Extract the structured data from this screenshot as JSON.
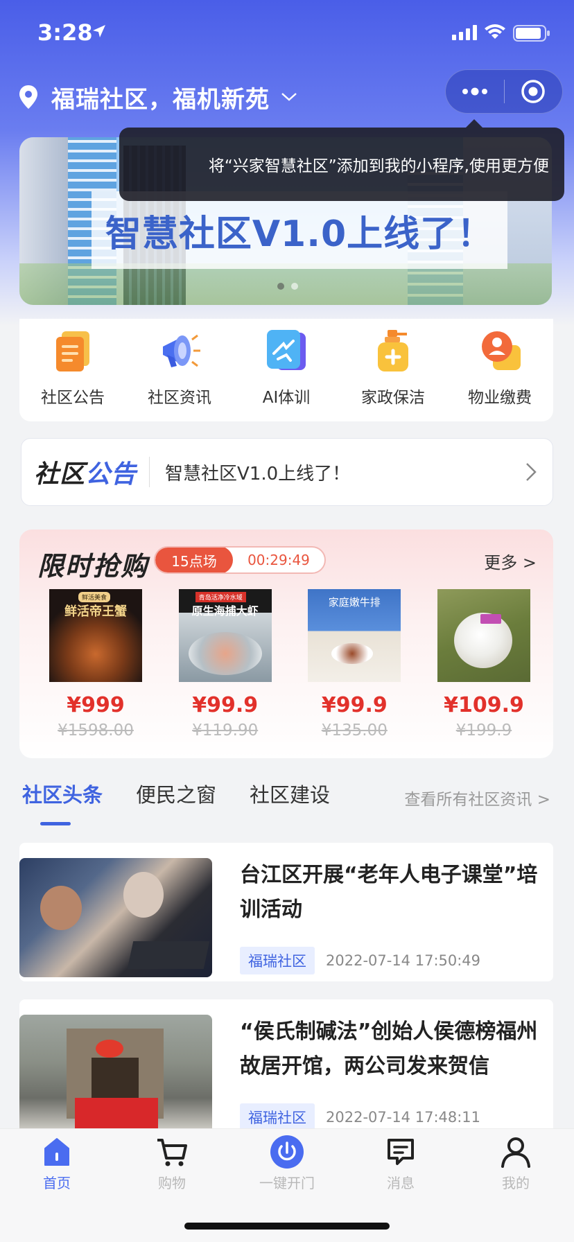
{
  "status_bar": {
    "time": "3:28"
  },
  "header": {
    "location": "福瑞社区，福机新苑",
    "icons": [
      "location-pin-icon",
      "chevron-down-icon",
      "more-dots-icon",
      "close-target-icon"
    ]
  },
  "tooltip": {
    "text": "将“兴家智慧社区”添加到我的小程序,使用更方便"
  },
  "banner": {
    "title": "智慧社区V1.0上线了！"
  },
  "quick_menu": [
    {
      "label": "社区公告",
      "icon": "notice-doc-icon"
    },
    {
      "label": "社区资讯",
      "icon": "megaphone-icon"
    },
    {
      "label": "AI体训",
      "icon": "ai-training-icon"
    },
    {
      "label": "家政保洁",
      "icon": "cleaning-bottle-icon"
    },
    {
      "label": "物业缴费",
      "icon": "property-fee-icon"
    }
  ],
  "notice": {
    "logo_part1": "社区",
    "logo_part2": "公告",
    "text": "智慧社区V1.0上线了！"
  },
  "flash_sale": {
    "title": "限时抢购",
    "session": "15点场",
    "countdown": "00:29:49",
    "more": "更多 >",
    "products": [
      {
        "price": "¥999",
        "original": "¥1598.00",
        "img_text": "鲜活帝王蟹",
        "img_top": "鲜活美食"
      },
      {
        "price": "¥99.9",
        "original": "¥119.90",
        "img_text": "原生海捕大虾",
        "img_top": "青岛活净冷水域"
      },
      {
        "price": "¥99.9",
        "original": "¥135.00",
        "img_text": "家庭嫩牛排",
        "img_top": ""
      },
      {
        "price": "¥109.9",
        "original": "¥199.9",
        "img_text": "",
        "img_top": ""
      }
    ]
  },
  "tabs": {
    "items": [
      "社区头条",
      "便民之窗",
      "社区建设"
    ],
    "active": 0,
    "more": "查看所有社区资讯 >"
  },
  "news": [
    {
      "title": "台江区开展“老年人电子课堂”培训活动",
      "tag": "福瑞社区",
      "time": "2022-07-14 17:50:49"
    },
    {
      "title": "“侯氏制碱法”创始人侯德榜福州故居开馆，两公司发来贺信",
      "tag": "福瑞社区",
      "time": "2022-07-14 17:48:11"
    }
  ],
  "bottom_nav": [
    {
      "label": "首页",
      "icon": "home-icon",
      "active": true
    },
    {
      "label": "购物",
      "icon": "cart-icon",
      "active": false
    },
    {
      "label": "一键开门",
      "icon": "power-icon",
      "active": false
    },
    {
      "label": "消息",
      "icon": "message-icon",
      "active": false
    },
    {
      "label": "我的",
      "icon": "user-icon",
      "active": false
    }
  ],
  "colors": {
    "accent": "#3f63e0",
    "sale_red": "#e2312b",
    "header_blue": "#4a5ee8"
  }
}
